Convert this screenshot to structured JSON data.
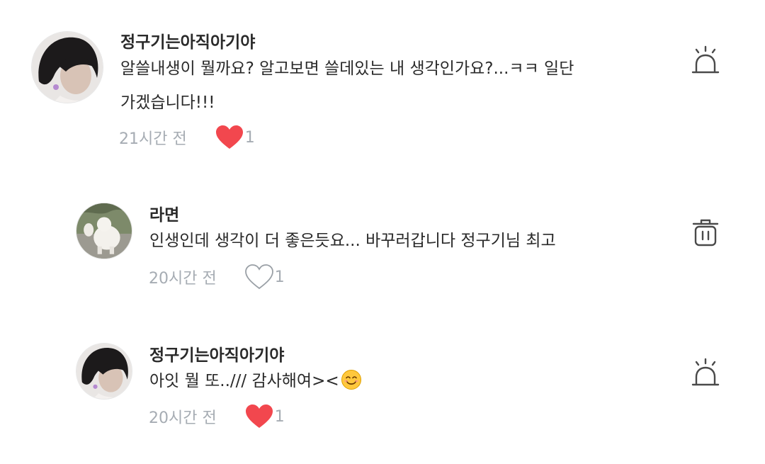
{
  "comments": [
    {
      "author": "정구기는아직아기야",
      "text_line1": "알쓸내생이 뭘까요? 알고보면 쓸데있는 내 생각인가요?...ㅋㅋ 일단",
      "text_line2": "가겠습니다!!!",
      "time": "21시간 전",
      "liked": true,
      "likes": "1",
      "action_icon": "report-icon"
    },
    {
      "author": "라면",
      "text_line1": "인생인데 생각이 더 좋은듯요... 바꾸러갑니다 정구기님 최고",
      "time": "20시간 전",
      "liked": false,
      "likes": "1",
      "action_icon": "trash-icon"
    },
    {
      "author": "정구기는아직아기야",
      "text_line1": "아잇 뭘 또../// 감사해여><",
      "emoji": "smiling-face-emoji",
      "time": "20시간 전",
      "liked": true,
      "likes": "1",
      "action_icon": "report-icon"
    }
  ],
  "colors": {
    "heart_filled": "#f2474e",
    "heart_outline": "#9aa0a6",
    "meta_text": "#a6acb3",
    "icon_stroke": "#4a4a4a"
  }
}
